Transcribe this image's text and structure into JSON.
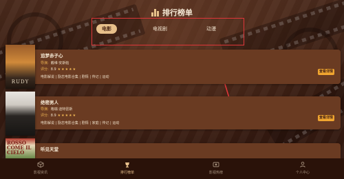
{
  "header": {
    "title": "排行榜单",
    "icon": "bar-chart-icon"
  },
  "tabs": [
    {
      "label": "电影",
      "active": true
    },
    {
      "label": "电视剧",
      "active": false
    },
    {
      "label": "动漫",
      "active": false
    }
  ],
  "movies": [
    {
      "title": "追梦赤子心",
      "director_label": "导演:",
      "director": "戴维·安斯帕",
      "rating_label": "评分:",
      "rating": "8.9",
      "stars": "★★★★★",
      "tags": "电影解说 | 励志电影合集 | 剧情 | 传记 | 运动",
      "detail_label": "查看详情",
      "poster_text": "RUDY"
    },
    {
      "title": "绝密男人",
      "director_label": "导演:",
      "director": "格瑞·迪特雷斯",
      "rating_label": "评分:",
      "rating": "8.9",
      "stars": "★★★★★",
      "tags": "电影解说 | 励志电影合集 | 剧情 | 家庭 | 传记 | 运动",
      "detail_label": "查看详情"
    },
    {
      "title": "听见天堂",
      "poster_text": "ROSSO COME IL CIELO"
    }
  ],
  "bottom_nav": [
    {
      "label": "影视资讯",
      "icon": "cube-icon",
      "active": false
    },
    {
      "label": "排行榜单",
      "icon": "rank-icon",
      "active": true
    },
    {
      "label": "影视热榜",
      "icon": "film-icon",
      "active": false
    },
    {
      "label": "个人中心",
      "icon": "person-icon",
      "active": false
    }
  ],
  "colors": {
    "accent": "#e8c08b",
    "highlight_box": "#e0373a",
    "button": "#f0a530"
  }
}
